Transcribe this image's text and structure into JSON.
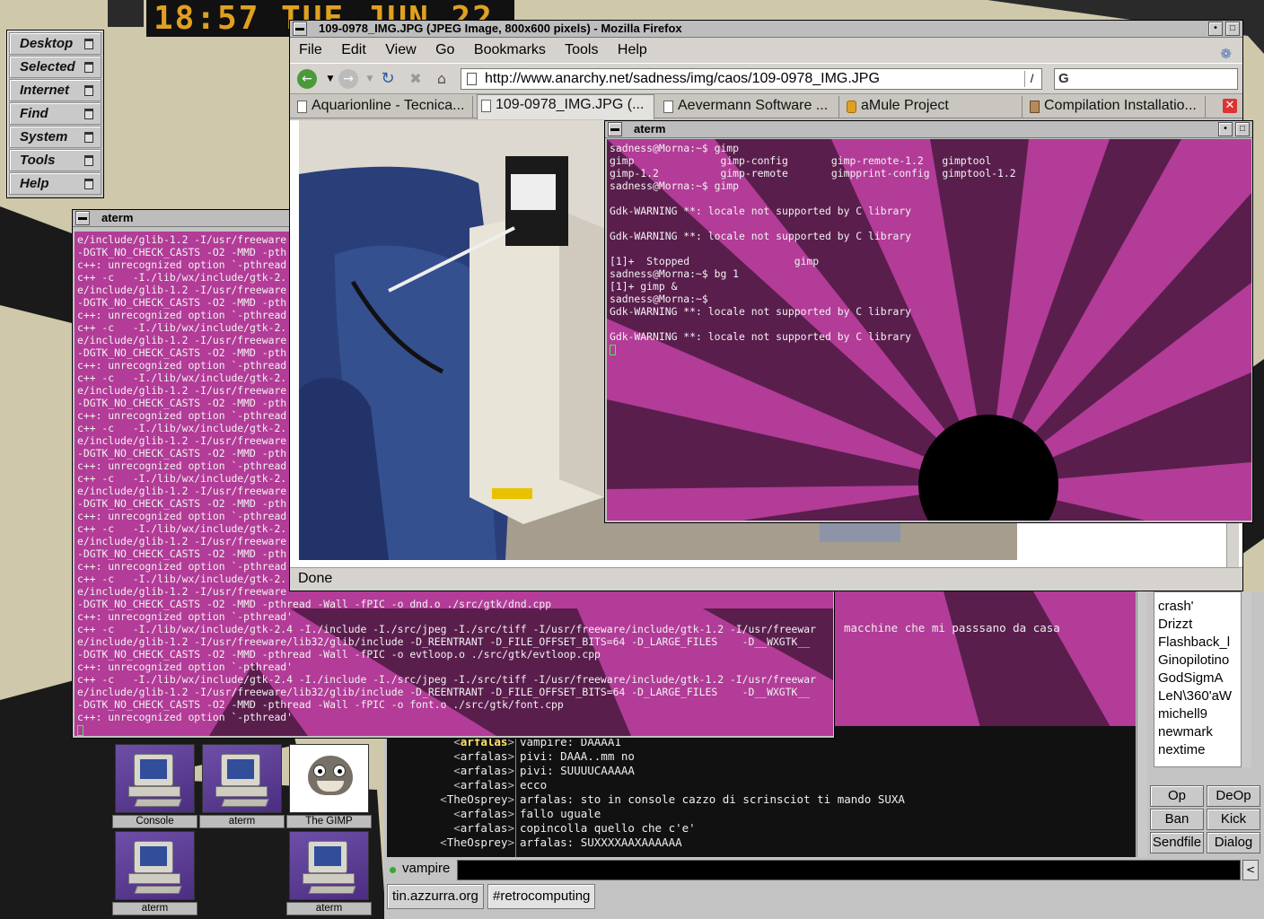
{
  "clock": {
    "text": "18:57  TUE  JUN 22"
  },
  "menu": {
    "items": [
      {
        "label": "Desktop"
      },
      {
        "label": "Selected"
      },
      {
        "label": "Internet"
      },
      {
        "label": "Find"
      },
      {
        "label": "System"
      },
      {
        "label": "Tools"
      },
      {
        "label": "Help"
      }
    ]
  },
  "aterm_left": {
    "title": "aterm",
    "lines": [
      "e/include/glib-1.2 -I/usr/freeware",
      "-DGTK_NO_CHECK_CASTS -O2 -MMD -pth",
      "c++: unrecognized option `-pthread",
      "c++ -c   -I./lib/wx/include/gtk-2.",
      "e/include/glib-1.2 -I/usr/freeware",
      "-DGTK_NO_CHECK_CASTS -O2 -MMD -pth",
      "c++: unrecognized option `-pthread",
      "c++ -c   -I./lib/wx/include/gtk-2.",
      "e/include/glib-1.2 -I/usr/freeware",
      "-DGTK_NO_CHECK_CASTS -O2 -MMD -pth",
      "c++: unrecognized option `-pthread",
      "c++ -c   -I./lib/wx/include/gtk-2.",
      "e/include/glib-1.2 -I/usr/freeware",
      "-DGTK_NO_CHECK_CASTS -O2 -MMD -pth",
      "c++: unrecognized option `-pthread",
      "c++ -c   -I./lib/wx/include/gtk-2.",
      "e/include/glib-1.2 -I/usr/freeware",
      "-DGTK_NO_CHECK_CASTS -O2 -MMD -pth",
      "c++: unrecognized option `-pthread",
      "c++ -c   -I./lib/wx/include/gtk-2.",
      "e/include/glib-1.2 -I/usr/freeware",
      "-DGTK_NO_CHECK_CASTS -O2 -MMD -pth",
      "c++: unrecognized option `-pthread",
      "c++ -c   -I./lib/wx/include/gtk-2.",
      "e/include/glib-1.2 -I/usr/freeware",
      "-DGTK_NO_CHECK_CASTS -O2 -MMD -pth",
      "c++: unrecognized option `-pthread",
      "c++ -c   -I./lib/wx/include/gtk-2.",
      "e/include/glib-1.2 -I/usr/freeware",
      "-DGTK_NO_CHECK_CASTS -O2 -MMD -pthread -Wall -fPIC -o dnd.o ./src/gtk/dnd.cpp",
      "c++: unrecognized option `-pthread'",
      "c++ -c   -I./lib/wx/include/gtk-2.4 -I./include -I./src/jpeg -I./src/tiff -I/usr/freeware/include/gtk-1.2 -I/usr/freewar",
      "e/include/glib-1.2 -I/usr/freeware/lib32/glib/include -D_REENTRANT -D_FILE_OFFSET_BITS=64 -D_LARGE_FILES    -D__WXGTK__",
      "-DGTK_NO_CHECK_CASTS -O2 -MMD -pthread -Wall -fPIC -o evtloop.o ./src/gtk/evtloop.cpp",
      "c++: unrecognized option `-pthread'",
      "c++ -c   -I./lib/wx/include/gtk-2.4 -I./include -I./src/jpeg -I./src/tiff -I/usr/freeware/include/gtk-1.2 -I/usr/freewar",
      "e/include/glib-1.2 -I/usr/freeware/lib32/glib/include -D_REENTRANT -D_FILE_OFFSET_BITS=64 -D_LARGE_FILES    -D__WXGTK__",
      "-DGTK_NO_CHECK_CASTS -O2 -MMD -pthread -Wall -fPIC -o font.o ./src/gtk/font.cpp",
      "c++: unrecognized option `-pthread'"
    ]
  },
  "firefox": {
    "title": "109-0978_IMG.JPG (JPEG Image, 800x600 pixels) - Mozilla Firefox",
    "menus": [
      "File",
      "Edit",
      "View",
      "Go",
      "Bookmarks",
      "Tools",
      "Help"
    ],
    "url": "http://www.anarchy.net/sadness/img/caos/109-0978_IMG.JPG",
    "search_engine": "G",
    "tabs": [
      {
        "label": "Aquarionline - Tecnica..."
      },
      {
        "label": "109-0978_IMG.JPG (..."
      },
      {
        "label": "Aevermann Software ..."
      },
      {
        "label": "aMule Project"
      },
      {
        "label": "Compilation Installatio..."
      }
    ],
    "status": "Done"
  },
  "aterm_right": {
    "title": "aterm",
    "lines": [
      "sadness@Morna:~$ gimp",
      "gimp              gimp-config       gimp-remote-1.2   gimptool",
      "gimp-1.2          gimp-remote       gimpprint-config  gimptool-1.2",
      "sadness@Morna:~$ gimp",
      "",
      "Gdk-WARNING **: locale not supported by C library",
      "",
      "Gdk-WARNING **: locale not supported by C library",
      "",
      "[1]+  Stopped                 gimp",
      "sadness@Morna:~$ bg 1",
      "[1]+ gimp &",
      "sadness@Morna:~$",
      "Gdk-WARNING **: locale not supported by C library",
      "",
      "Gdk-WARNING **: locale not supported by C library"
    ]
  },
  "irc": {
    "topline": "macchine che mi passsano da casa",
    "messages": [
      {
        "nick": "arfalas",
        "text": "vampire: DAAAA1"
      },
      {
        "nick": "arfalas",
        "text": "pivi: DAAA..mm no"
      },
      {
        "nick": "arfalas",
        "text": "pivi: SUUUUCAAAAA"
      },
      {
        "nick": "arfalas",
        "text": "ecco"
      },
      {
        "nick": "TheOsprey",
        "text": "arfalas: sto in console cazzo di scrinsciot ti mando SUXA"
      },
      {
        "nick": "arfalas",
        "text": "fallo uguale"
      },
      {
        "nick": "arfalas",
        "text": "copincolla quello che c'e'"
      },
      {
        "nick": "TheOsprey",
        "text": "arfalas: SUXXXXAAXAAAAAA"
      }
    ],
    "users": [
      "crash'",
      "Drizzt",
      "Flashback_l",
      "Ginopilotino",
      "GodSigmA",
      "LeN\\360'aW",
      "michell9",
      "newmark",
      "nextime"
    ],
    "buttons": [
      "Op",
      "DeOp",
      "Ban",
      "Kick",
      "Sendfile",
      "Dialog"
    ],
    "nick": "vampire",
    "input_value": "",
    "tabs": [
      "tin.azzurra.org",
      "#retrocomputing"
    ]
  },
  "desktop_icons": [
    {
      "label": "Console"
    },
    {
      "label": "aterm"
    },
    {
      "label": "The GIMP"
    },
    {
      "label": "aterm"
    },
    {
      "label": "aterm"
    }
  ],
  "colors": {
    "terminal_magenta": "#b23c97",
    "terminal_dark": "#5a1e4d",
    "desktop_beige": "#cfc8ab",
    "clock_amber": "#e0a020"
  }
}
